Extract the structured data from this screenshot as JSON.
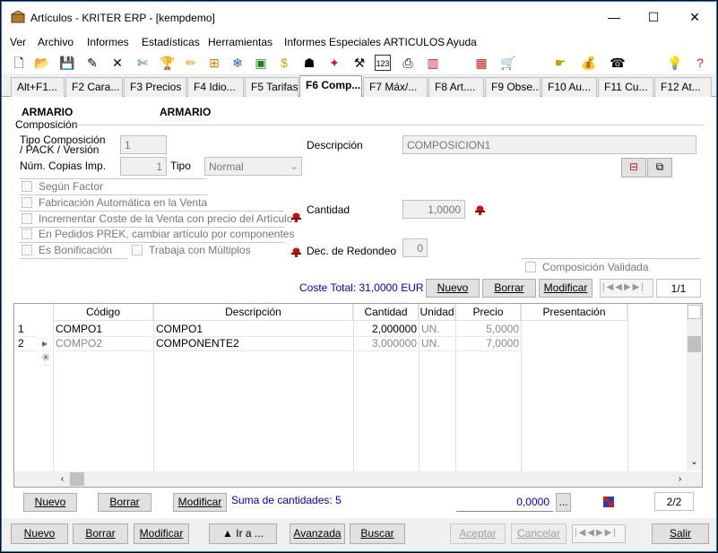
{
  "window": {
    "title": "Artículos - KRITER ERP - [kempdemo]",
    "minimize": "—",
    "maximize": "☐",
    "close": "✕"
  },
  "menu": [
    "Ver",
    "Archivo",
    "Informes",
    "Estadísticas",
    "Herramientas",
    "Informes Especiales ARTICULOS",
    "Ayuda"
  ],
  "tabs": [
    "Alt+F1...",
    "F2 Cara...",
    "F3 Precios",
    "F4 Idio...",
    "F5 Tarifas",
    "F6 Comp...",
    "F7 Máx/...",
    "F8 Art....",
    "F9 Obse...",
    "F10 Au...",
    "F11 Cu...",
    "F12 At..."
  ],
  "active_tab": "F6 Comp...",
  "header": {
    "code": "ARMARIO",
    "name": "ARMARIO",
    "group_label": "Composición"
  },
  "composition": {
    "tipo_label": "Tipo Composición / PACK / Versión",
    "tipo_value": "1",
    "copias_label": "Núm. Copias Imp.",
    "copias_value": "1",
    "tipo2_label": "Tipo",
    "tipo2_value": "Normal",
    "descripcion_label": "Descripción",
    "descripcion_value": "COMPOSICION1",
    "cantidad_label": "Cantidad",
    "cantidad_value": "1,0000",
    "redondeo_label": "Dec. de Redondeo",
    "redondeo_value": "0",
    "checks": {
      "segun_factor": "Según Factor",
      "fabricacion": "Fabricación Automática en la Venta",
      "incrementar": "Incrementar Coste de la Venta con precio del Artículo.",
      "pedidos": "En Pedidos PREK, cambiar artículo por componentes",
      "bonificacion": "Es Bonificación",
      "multiplos": "Trabaja con Múltiplos",
      "validada": "Composición Validada"
    },
    "coste_total": "Coste Total: 31,0000 EUR",
    "record_counter": "1/1"
  },
  "buttons": {
    "nuevo": "Nuevo",
    "borrar": "Borrar",
    "modificar": "Modificar",
    "ir_a": "▲  Ir a ...",
    "avanzada": "Avanzada",
    "buscar": "Buscar",
    "aceptar": "Aceptar",
    "cancelar": "Cancelar",
    "salir": "Salir",
    "ellipsis": "..."
  },
  "grid": {
    "columns": [
      "Código",
      "Descripción",
      "Cantidad",
      "Unidad",
      "Precio",
      "Presentación"
    ],
    "rows": [
      {
        "n": "1",
        "indicator": "",
        "codigo": "COMPO1",
        "descripcion": "COMPO1",
        "cantidad": "2,000000",
        "unidad": "UN.",
        "precio": "5,0000",
        "presentacion": ""
      },
      {
        "n": "2",
        "indicator": "▸",
        "codigo": "COMPO2",
        "descripcion": "COMPONENTE2",
        "cantidad": "3,000000",
        "unidad": "UN.",
        "precio": "7,0000",
        "presentacion": ""
      }
    ],
    "new_row_indicator": "✳"
  },
  "footer": {
    "suma": "Suma de cantidades: 5",
    "total_value": "0,0000",
    "page_counter": "2/2"
  },
  "colors": {
    "accent": "#1883d7",
    "link_blue": "#0000c0",
    "hat_red": "#c81010"
  }
}
